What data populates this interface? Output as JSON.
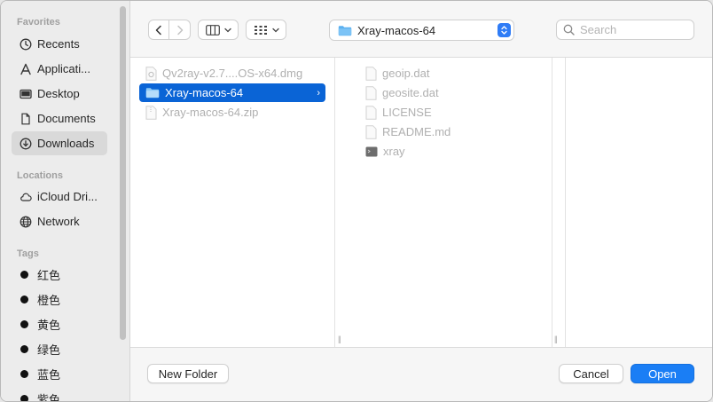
{
  "sidebar": {
    "favorites_heading": "Favorites",
    "favorites": [
      {
        "label": "Recents",
        "icon": "clock-icon"
      },
      {
        "label": "Applicati...",
        "icon": "applications-icon"
      },
      {
        "label": "Desktop",
        "icon": "desktop-icon"
      },
      {
        "label": "Documents",
        "icon": "document-icon"
      },
      {
        "label": "Downloads",
        "icon": "download-icon",
        "selected": true
      }
    ],
    "locations_heading": "Locations",
    "locations": [
      {
        "label": "iCloud Dri...",
        "icon": "cloud-icon"
      },
      {
        "label": "Network",
        "icon": "globe-icon"
      }
    ],
    "tags_heading": "Tags",
    "tags": [
      {
        "label": "红色"
      },
      {
        "label": "橙色"
      },
      {
        "label": "黄色"
      },
      {
        "label": "绿色"
      },
      {
        "label": "蓝色"
      },
      {
        "label": "紫色"
      }
    ]
  },
  "toolbar": {
    "back_icon": "chevron-left-icon",
    "forward_icon": "chevron-right-icon",
    "view_icon": "column-view-icon",
    "group_icon": "grid-icon",
    "path_label": "Xray-macos-64",
    "search_placeholder": "Search"
  },
  "columns": {
    "downloads": [
      {
        "name": "Qv2ray-v2.7....OS-x64.dmg",
        "icon": "dmg-file-icon"
      },
      {
        "name": "Xray-macos-64",
        "icon": "folder-icon",
        "selected": true
      },
      {
        "name": "Xray-macos-64.zip",
        "icon": "zip-file-icon"
      }
    ],
    "xray_folder": [
      {
        "name": "geoip.dat",
        "icon": "file-icon"
      },
      {
        "name": "geosite.dat",
        "icon": "file-icon"
      },
      {
        "name": "LICENSE",
        "icon": "file-icon"
      },
      {
        "name": "README.md",
        "icon": "file-icon"
      },
      {
        "name": "xray",
        "icon": "executable-icon"
      }
    ]
  },
  "footer": {
    "new_folder_label": "New Folder",
    "cancel_label": "Cancel",
    "open_label": "Open"
  },
  "colors": {
    "accent": "#0a64d6",
    "primary_button": "#1a7ef5",
    "folder": "#5ab0f0"
  }
}
